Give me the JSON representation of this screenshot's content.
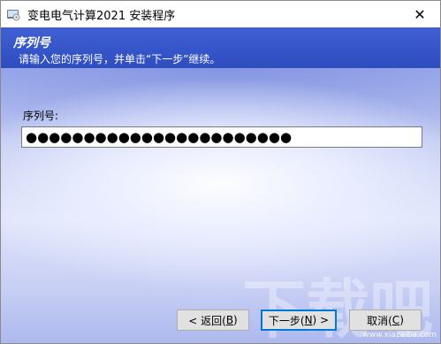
{
  "window": {
    "title": "变电电气计算2021 安装程序",
    "close_label": "✕"
  },
  "header": {
    "title": "序列号",
    "subtitle": "请输入您的序列号，并单击“下一步”继续。"
  },
  "form": {
    "serial_label": "序列号:",
    "serial_value": "●●●●●●●●●●●●●●●●●●●●●●●"
  },
  "buttons": {
    "back_prefix": "< 返回(",
    "back_key": "B",
    "back_suffix": ")",
    "next_prefix": "下一步(",
    "next_key": "N",
    "next_suffix": ") >",
    "cancel_prefix": "取消(",
    "cancel_key": "C",
    "cancel_suffix": ")"
  },
  "watermark": {
    "big": "下载吧",
    "small": "www.xiazaiba.com"
  },
  "colors": {
    "header_blue": "#3650c9",
    "focus_border": "#0078d7"
  }
}
